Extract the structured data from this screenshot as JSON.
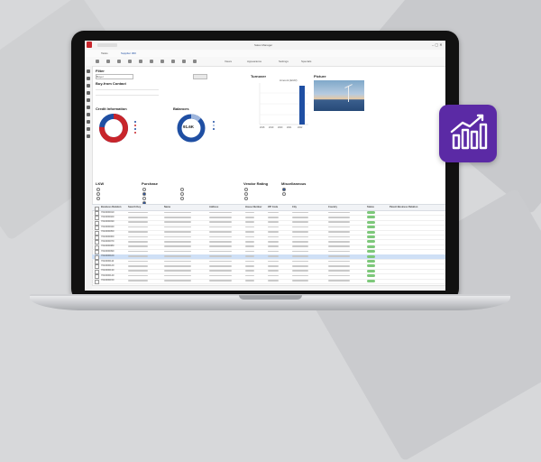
{
  "window": {
    "title": "Sales Manager"
  },
  "tabs": [
    {
      "label": "Tasks"
    },
    {
      "label": "Supplier 300"
    }
  ],
  "toolbar": {
    "items": [
      {
        "label": "Views"
      },
      {
        "label": "Appearance"
      },
      {
        "label": "Settings"
      },
      {
        "label": "Specials"
      }
    ]
  },
  "filter": {
    "title": "Filter",
    "value": "Buyer"
  },
  "buy_from_contact": {
    "title": "Buy-from Contact"
  },
  "credit_information": {
    "title": "Credit Information"
  },
  "balances": {
    "title": "Balances",
    "donut_value": "91.6K"
  },
  "turnover": {
    "title": "Turnover",
    "series_name": "Amount (EUR)",
    "years": [
      "2018",
      "2019",
      "2020",
      "2021",
      "2022"
    ]
  },
  "picture": {
    "title": "Picture"
  },
  "sections": {
    "lkw": "LKW",
    "purchase": "Purchase",
    "vendor_rating": "Vendor Rating",
    "miscellaneous": "Miscellaneous"
  },
  "grid": {
    "headers": [
      "Business Relation",
      "Search Key",
      "Name",
      "Address",
      "House Number",
      "ZIP Code",
      "City",
      "Country",
      "Status",
      "Parent Business Relation"
    ],
    "rows": [
      {
        "id": "7010000010"
      },
      {
        "id": "7010000020"
      },
      {
        "id": "7010000030"
      },
      {
        "id": "7010000040"
      },
      {
        "id": "7010000050"
      },
      {
        "id": "7010000060"
      },
      {
        "id": "7010000070"
      },
      {
        "id": "7010000080"
      },
      {
        "id": "7010000090"
      },
      {
        "id": "7010000100"
      },
      {
        "id": "7010000110"
      },
      {
        "id": "7010000120"
      },
      {
        "id": "7010000130"
      },
      {
        "id": "7010000140"
      },
      {
        "id": "7010000150"
      }
    ]
  },
  "colors": {
    "accent": "#1f4fa3",
    "donut_red": "#c8252b",
    "donut_blue": "#1f4fa3",
    "badge": "#5b2aa5",
    "status_green": "#7dc87a"
  },
  "icons": {
    "app_badge": "analytics-chart-icon"
  }
}
